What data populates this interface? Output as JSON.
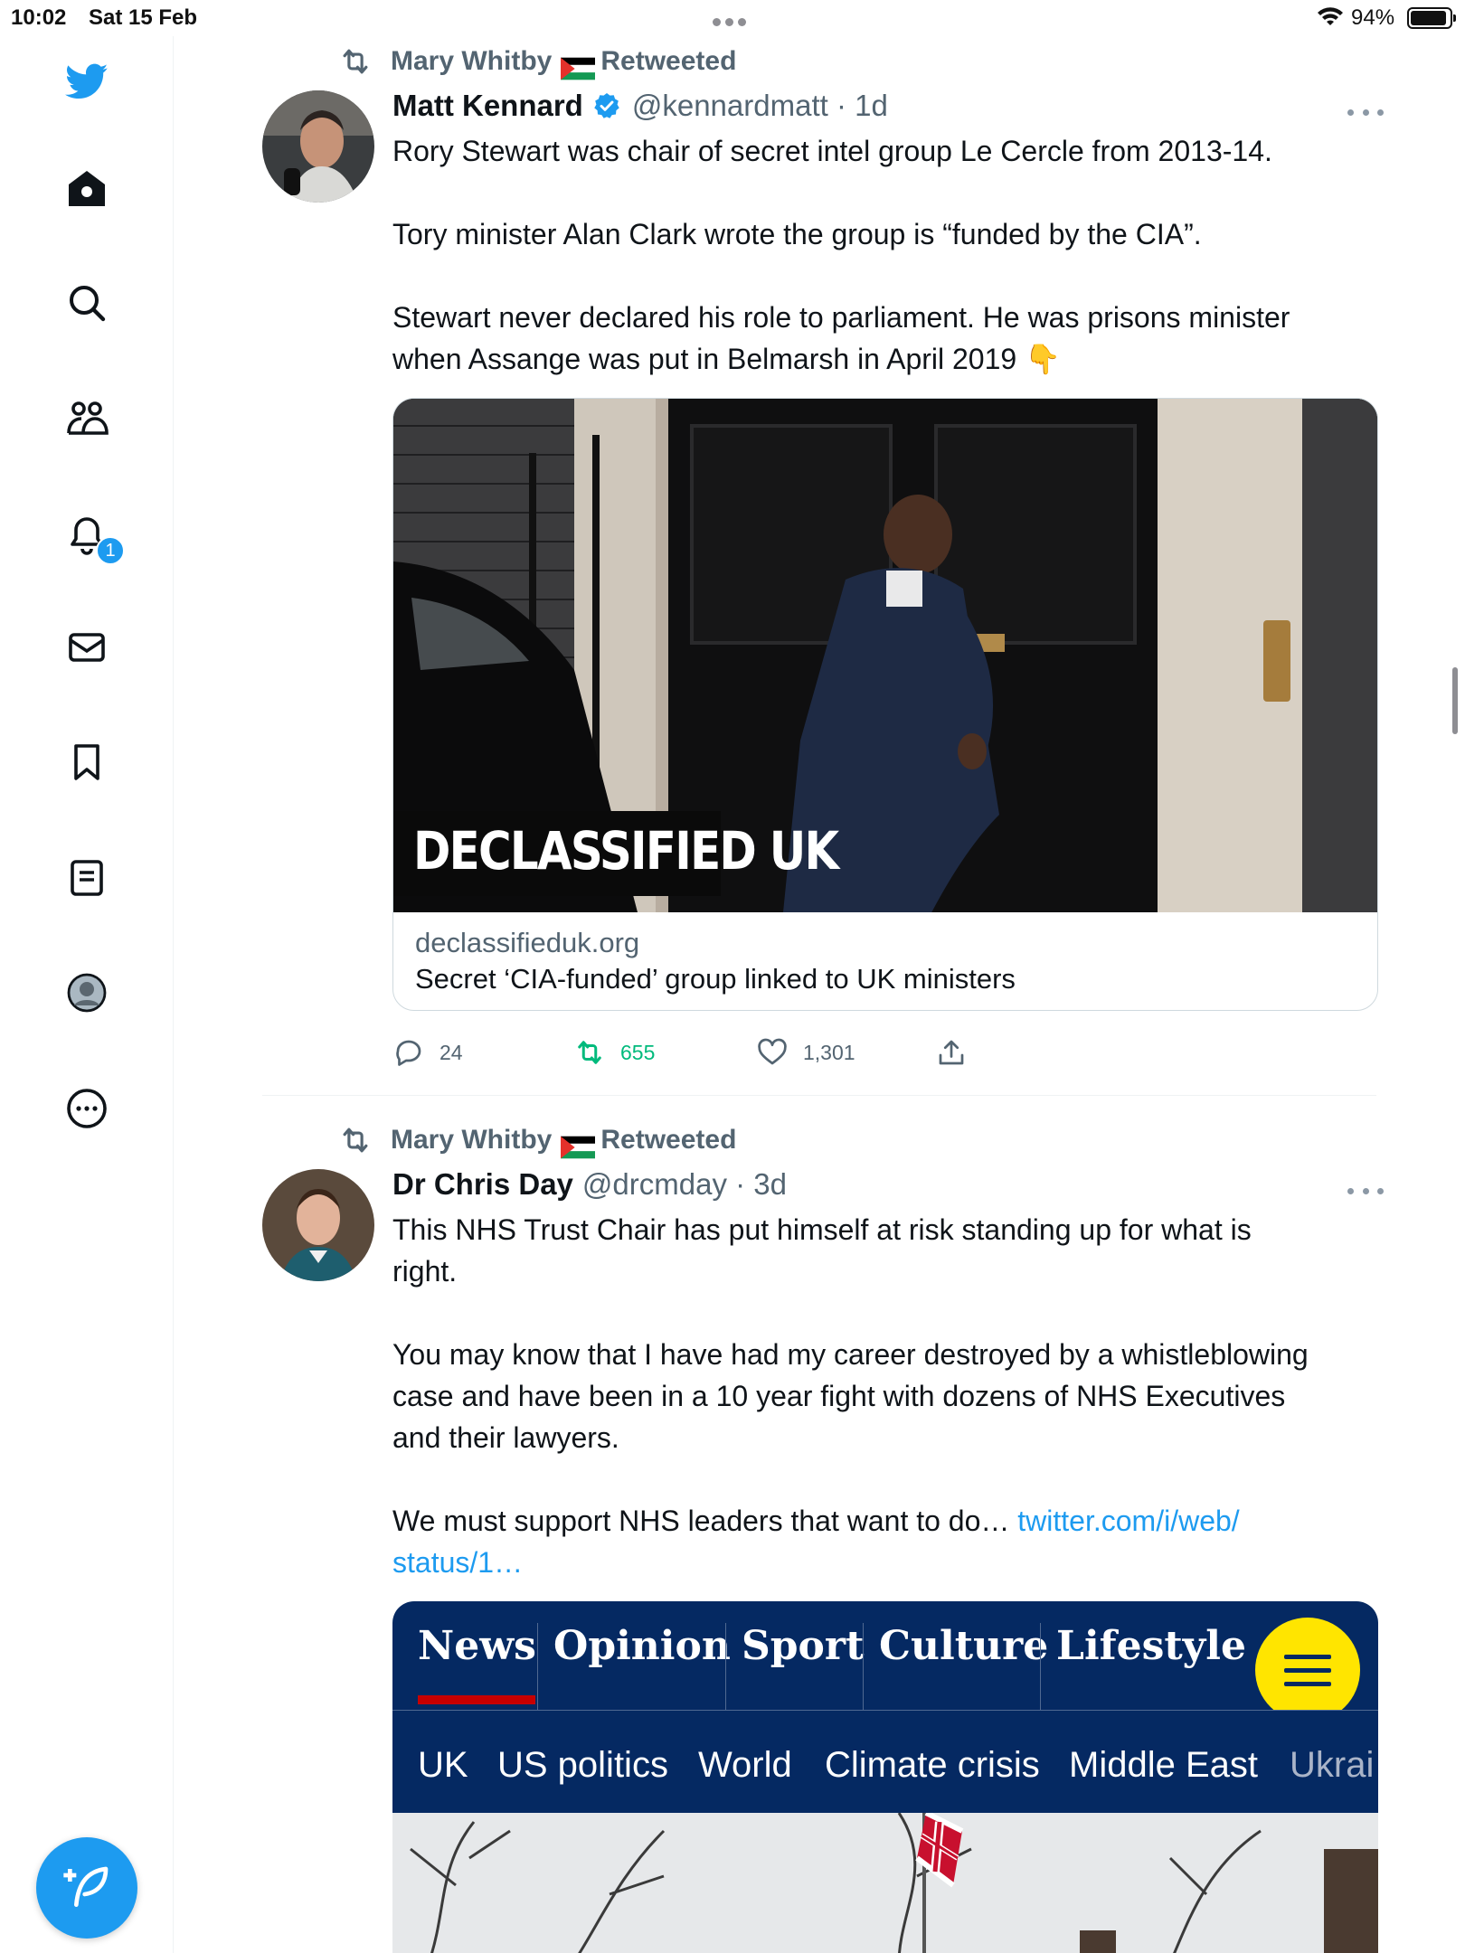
{
  "status_bar": {
    "time": "10:02",
    "date": "Sat 15 Feb",
    "battery": "94%",
    "battery_level": 0.94
  },
  "sidebar": {
    "items": [
      {
        "name": "twitter-logo-icon"
      },
      {
        "name": "home-icon"
      },
      {
        "name": "search-icon"
      },
      {
        "name": "communities-icon"
      },
      {
        "name": "notifications-icon"
      },
      {
        "name": "messages-icon"
      },
      {
        "name": "bookmarks-icon"
      },
      {
        "name": "lists-icon"
      },
      {
        "name": "profile-icon"
      },
      {
        "name": "more-icon"
      }
    ],
    "notifications_badge": "1",
    "compose_icon": "compose-tweet-icon"
  },
  "colors": {
    "accent": "#1d9bf0",
    "retweet_green": "#00ba7c",
    "guardian_blue": "#052962",
    "guardian_yellow": "#ffe500",
    "guardian_red": "#c70000"
  },
  "tweets": [
    {
      "retweeted_by": "Mary Whitby",
      "retweeted_label": "Retweeted",
      "author_name": "Matt Kennard",
      "verified": true,
      "handle_time": "@kennardmatt · 1d",
      "body": [
        "Rory Stewart was chair of secret intel group Le Cercle from 2013-14.",
        "",
        "Tory minister Alan Clark wrote the group is “funded by the CIA”.",
        "",
        "Stewart never declared his role to parliament. He was prisons minister",
        "when Assange was put in Belmarsh in April 2019 👇"
      ],
      "card": {
        "image_text": "DECLASSIFIED UK",
        "domain": "declassifieduk.org",
        "title": "Secret ‘CIA-funded’ group linked to UK ministers"
      },
      "actions": {
        "replies": "24",
        "retweets": "655",
        "likes": "1,301"
      }
    },
    {
      "retweeted_by": "Mary Whitby",
      "retweeted_label": "Retweeted",
      "author_name": "Dr Chris Day",
      "verified": false,
      "handle_time": "@drcmday · 3d",
      "body": [
        "This NHS Trust Chair has put himself at risk standing up for what is",
        "right.",
        "",
        "You may  know that I have had my career destroyed by a whistleblowing",
        "case and have been in a 10 year fight with dozens of NHS Executives",
        "and their lawyers.",
        "",
        "We must support NHS leaders that want to do… "
      ],
      "link_part1": "twitter.com/i/web/",
      "link_part2": "status/1…",
      "guardian": {
        "pillars": [
          "News",
          "Opinion",
          "Sport",
          "Culture",
          "Lifestyle"
        ],
        "subnav": [
          "UK",
          "US politics",
          "World",
          "Climate crisis",
          "Middle East",
          "Ukrai"
        ]
      }
    }
  ]
}
